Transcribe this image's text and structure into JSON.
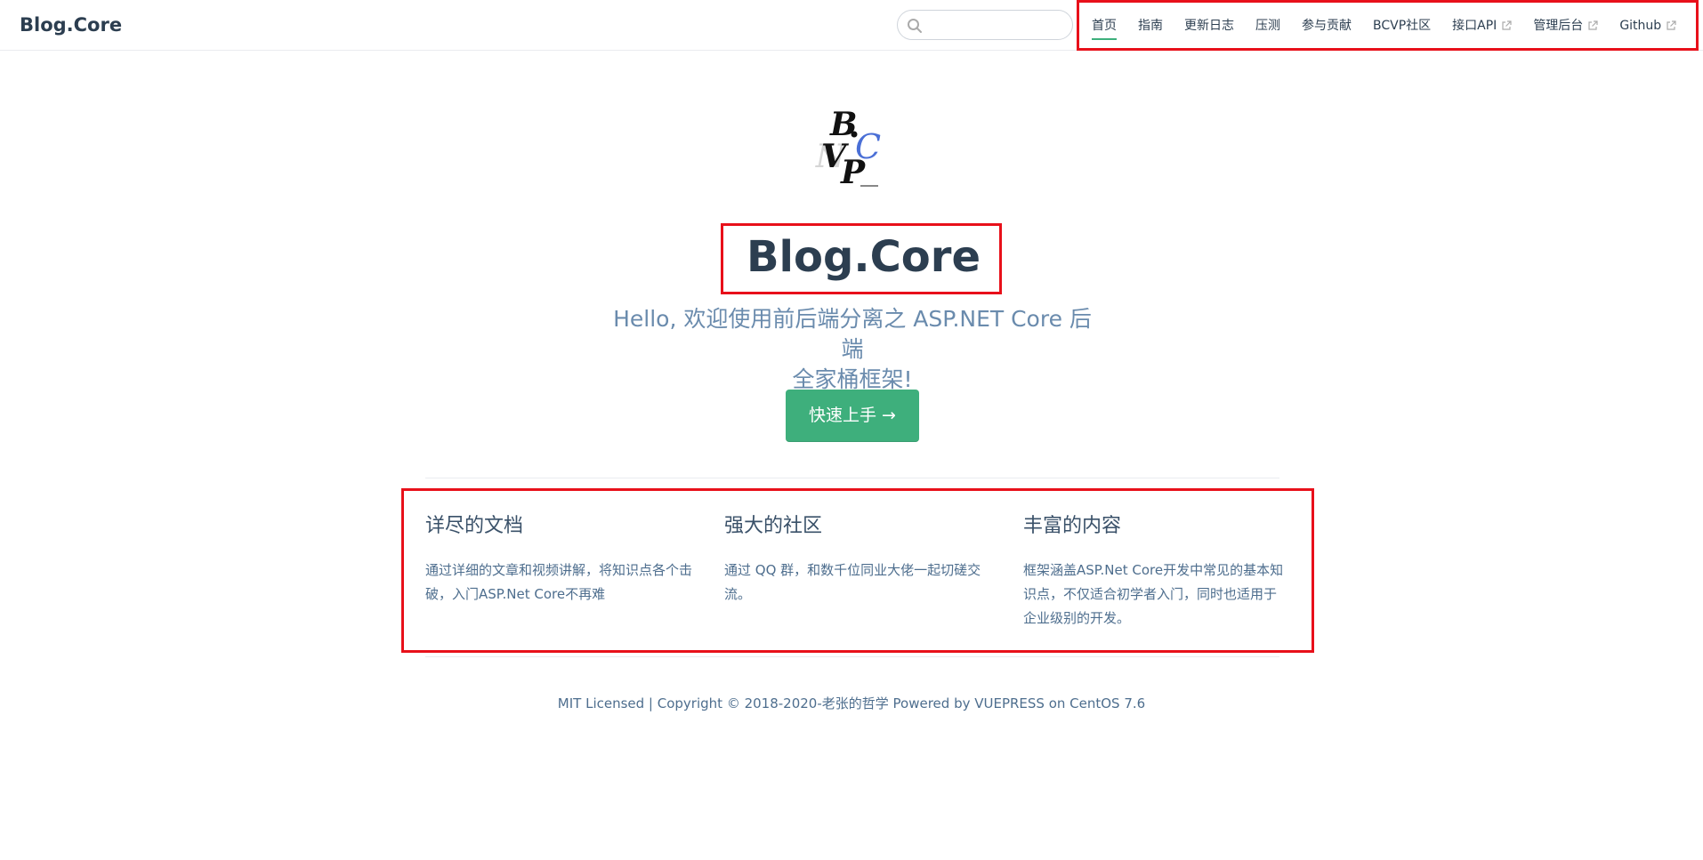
{
  "navbar": {
    "site_name": "Blog.Core",
    "search": {
      "placeholder": "",
      "value": ""
    },
    "links": [
      {
        "label": "首页",
        "external": false,
        "active": true
      },
      {
        "label": "指南",
        "external": false,
        "active": false
      },
      {
        "label": "更新日志",
        "external": false,
        "active": false
      },
      {
        "label": "压测",
        "external": false,
        "active": false
      },
      {
        "label": "参与贡献",
        "external": false,
        "active": false
      },
      {
        "label": "BCVP社区",
        "external": false,
        "active": false
      },
      {
        "label": "接口API",
        "external": true,
        "active": false
      },
      {
        "label": "管理后台",
        "external": true,
        "active": false
      },
      {
        "label": "Github",
        "external": true,
        "active": false
      }
    ]
  },
  "hero": {
    "logo_icon": "bcvp-logo",
    "title": "Blog.Core",
    "description_line1": "Hello, 欢迎使用前后端分离之 ASP.NET Core 后端",
    "description_line2": "全家桶框架!",
    "action_label": "快速上手 →"
  },
  "features": [
    {
      "title": "详尽的文档",
      "details": "通过详细的文章和视频讲解，将知识点各个击破，入门ASP.Net Core不再难"
    },
    {
      "title": "强大的社区",
      "details": "通过 QQ 群，和数千位同业大佬一起切磋交流。"
    },
    {
      "title": "丰富的内容",
      "details": "框架涵盖ASP.Net Core开发中常见的基本知识点，不仅适合初学者入门，同时也适用于企业级别的开发。"
    }
  ],
  "footer": {
    "text": "MIT Licensed | Copyright © 2018-2020-老张的哲学 Powered by VUEPRESS on CentOS 7.6"
  },
  "colors": {
    "accent": "#3eaf7c",
    "text": "#2c3e50",
    "description": "#6a8bad",
    "highlight_border": "#e8101a"
  }
}
